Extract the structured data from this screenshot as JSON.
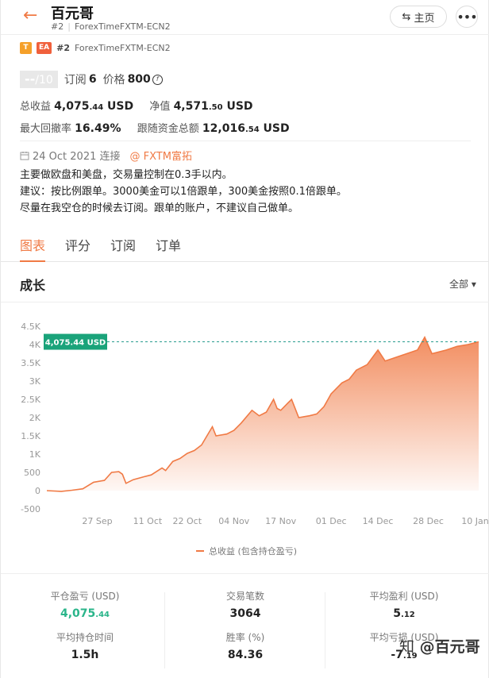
{
  "header": {
    "title": "百元哥",
    "rank": "#2",
    "broker": "ForexTimeFXTM-ECN2",
    "home_label": "主页",
    "more_label": "•••"
  },
  "badges": {
    "t": "T",
    "ea": "EA",
    "rank": "#2",
    "broker": "ForexTimeFXTM-ECN2"
  },
  "rating": {
    "score": "--",
    "out_of": "/10",
    "subscribe_label": "订阅",
    "subscribe_value": "6",
    "price_label": "价格",
    "price_value": "800"
  },
  "stats": {
    "total_profit_label": "总收益",
    "total_profit_main": "4,075",
    "total_profit_dec": ".44",
    "total_profit_unit": "USD",
    "net_label": "净值",
    "net_main": "4,571",
    "net_dec": ".50",
    "net_unit": "USD",
    "drawdown_label": "最大回撤率",
    "drawdown_value": "16.49%",
    "follow_label": "跟随资金总额",
    "follow_main": "12,016",
    "follow_dec": ".54",
    "follow_unit": "USD"
  },
  "connection": {
    "date": "24 Oct 2021 连接",
    "broker_link": "@ FXTM富拓"
  },
  "description": [
    "主要做欧盘和美盘，交易量控制在0.3手以内。",
    "建议：按比例跟单。3000美金可以1倍跟单，300美金按照0.1倍跟单。",
    "尽量在我空仓的时候去订阅。跟单的账户，不建议自己做单。"
  ],
  "tabs": [
    "图表",
    "评分",
    "订阅",
    "订单"
  ],
  "growth": {
    "title": "成长",
    "range": "全部 ▾"
  },
  "chart_data": {
    "type": "area",
    "title": "",
    "xlabel": "",
    "ylabel": "",
    "ylim": [
      -500,
      4500
    ],
    "y_ticks": [
      "4.5K",
      "4K",
      "3.5K",
      "3K",
      "2.5K",
      "2K",
      "1.5K",
      "1K",
      "500",
      "0",
      "-500"
    ],
    "y_tick_values": [
      4500,
      4000,
      3500,
      3000,
      2500,
      2000,
      1500,
      1000,
      500,
      0,
      -500
    ],
    "x_ticks": [
      "27 Sep",
      "11 Oct",
      "22 Oct",
      "04 Nov",
      "17 Nov",
      "01 Dec",
      "14 Dec",
      "28 Dec",
      "10 Jan"
    ],
    "x_tick_values": [
      "2021-09-27",
      "2021-10-11",
      "2021-10-22",
      "2021-11-04",
      "2021-11-17",
      "2021-12-01",
      "2021-12-14",
      "2021-12-28",
      "2022-01-10"
    ],
    "current_value_label": "4,075.44 USD",
    "current_value": 4075.44,
    "series": [
      {
        "name": "总收益 (包含持仓盈亏)",
        "color": "#f07a45",
        "points": [
          [
            "2021-09-13",
            0
          ],
          [
            "2021-09-17",
            -20
          ],
          [
            "2021-09-20",
            10
          ],
          [
            "2021-09-23",
            50
          ],
          [
            "2021-09-26",
            230
          ],
          [
            "2021-09-29",
            280
          ],
          [
            "2021-10-01",
            500
          ],
          [
            "2021-10-03",
            520
          ],
          [
            "2021-10-04",
            450
          ],
          [
            "2021-10-05",
            200
          ],
          [
            "2021-10-07",
            300
          ],
          [
            "2021-10-10",
            380
          ],
          [
            "2021-10-12",
            430
          ],
          [
            "2021-10-15",
            620
          ],
          [
            "2021-10-16",
            550
          ],
          [
            "2021-10-18",
            800
          ],
          [
            "2021-10-20",
            880
          ],
          [
            "2021-10-22",
            1020
          ],
          [
            "2021-10-24",
            1100
          ],
          [
            "2021-10-26",
            1250
          ],
          [
            "2021-10-29",
            1750
          ],
          [
            "2021-10-30",
            1500
          ],
          [
            "2021-11-02",
            1550
          ],
          [
            "2021-11-04",
            1650
          ],
          [
            "2021-11-06",
            1850
          ],
          [
            "2021-11-09",
            2200
          ],
          [
            "2021-11-11",
            2050
          ],
          [
            "2021-11-13",
            2150
          ],
          [
            "2021-11-15",
            2500
          ],
          [
            "2021-11-16",
            2250
          ],
          [
            "2021-11-17",
            2200
          ],
          [
            "2021-11-19",
            2400
          ],
          [
            "2021-11-20",
            2500
          ],
          [
            "2021-11-22",
            2000
          ],
          [
            "2021-11-25",
            2050
          ],
          [
            "2021-11-27",
            2100
          ],
          [
            "2021-11-29",
            2300
          ],
          [
            "2021-12-01",
            2650
          ],
          [
            "2021-12-04",
            2950
          ],
          [
            "2021-12-06",
            3050
          ],
          [
            "2021-12-08",
            3300
          ],
          [
            "2021-12-11",
            3450
          ],
          [
            "2021-12-14",
            3850
          ],
          [
            "2021-12-16",
            3550
          ],
          [
            "2021-12-19",
            3650
          ],
          [
            "2021-12-22",
            3750
          ],
          [
            "2021-12-25",
            3850
          ],
          [
            "2021-12-27",
            4200
          ],
          [
            "2021-12-29",
            3750
          ],
          [
            "2022-01-02",
            3850
          ],
          [
            "2022-01-05",
            3950
          ],
          [
            "2022-01-08",
            4000
          ],
          [
            "2022-01-11",
            4075.44
          ]
        ]
      }
    ],
    "legend_placement": "bottom",
    "grid": false,
    "reference_line": "dashed horizontal at current value"
  },
  "metrics": [
    {
      "label": "平仓盈亏 (USD)",
      "value_main": "4,075",
      "value_dec": ".44",
      "color": "#2ab58a"
    },
    {
      "label": "交易笔数",
      "value_main": "3064",
      "value_dec": ""
    },
    {
      "label": "平均盈利 (USD)",
      "value_main": "5",
      "value_dec": ".12"
    },
    {
      "label": "平均持仓时间",
      "value_main": "1.5h",
      "value_dec": ""
    },
    {
      "label": "胜率 (%)",
      "value_main": "84.36",
      "value_dec": ""
    },
    {
      "label": "平均亏损 (USD)",
      "value_main": "-7",
      "value_dec": ".19"
    }
  ],
  "watermark": "百元哥"
}
